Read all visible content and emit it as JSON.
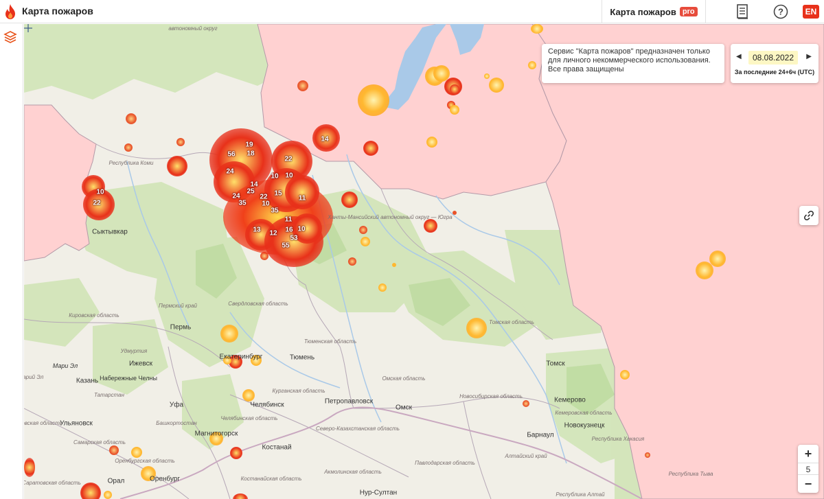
{
  "header": {
    "title": "Карта пожаров",
    "pro_label": "Карта пожаров",
    "pro_badge": "pro",
    "lang_button": "EN"
  },
  "notice": {
    "text": "Сервис \"Карта пожаров\" предназначен только для личного некоммерческого использования. Все права защищены"
  },
  "date_control": {
    "date": "08.08.2022",
    "period": "За последние 24+6ч (UTC)"
  },
  "zoom": {
    "in": "+",
    "level": "5",
    "out": "−"
  },
  "map": {
    "cities": [
      "Сыктывкар",
      "Пермь",
      "Ижевск",
      "Набережные Челны",
      "Казань",
      "Екатеринбург",
      "Тюмень",
      "Челябинск",
      "Уфа",
      "Магнитогорск",
      "Оренбург",
      "Костанай",
      "Петропавловск",
      "Омск",
      "Томск",
      "Кемерово",
      "Новокузнецк",
      "Барнаул",
      "Ульяновск",
      "Орал",
      "Нур-Султан",
      "Мари Эл"
    ],
    "regions": [
      "Республика Коми",
      "Пермский край",
      "Кировская область",
      "Удмуртия",
      "Татарстан",
      "Башкортостан",
      "Свердловская область",
      "Тюменская область",
      "Курганская область",
      "Челябинская область",
      "Оренбургская область",
      "Самарская область",
      "Саратовская область",
      "Омская область",
      "Новосибирская область",
      "Томская область",
      "Кемеровская область",
      "Алтайский край",
      "Республика Хакасия",
      "Республика Тыва",
      "Республика Алтай",
      "Павлодарская область",
      "Акмолинская область",
      "Костанайская область",
      "Северо-Казахстанская область",
      "Ханты-Мансийский автономный округ — Югра",
      "автономный округ",
      "Ульяновская область",
      "Марий Эл"
    ],
    "cluster_counts": [
      "56",
      "19",
      "18",
      "22",
      "24",
      "10",
      "10",
      "14",
      "25",
      "15",
      "24",
      "35",
      "22",
      "10",
      "11",
      "35",
      "11",
      "13",
      "16",
      "10",
      "12",
      "53",
      "55",
      "14",
      "10",
      "22"
    ]
  }
}
